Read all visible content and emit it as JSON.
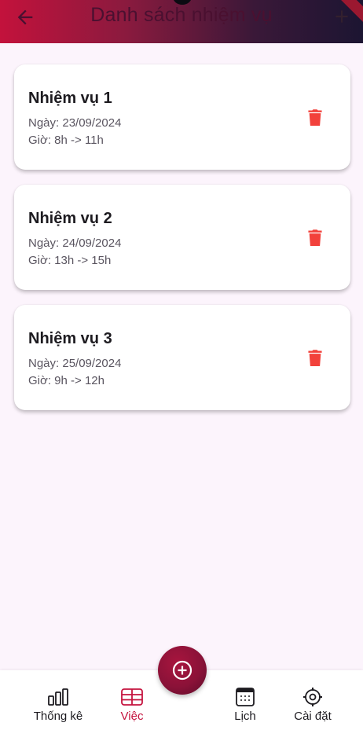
{
  "appbar": {
    "title": "Danh sách nhiệm vụ"
  },
  "tasks": [
    {
      "title": "Nhiệm vụ 1",
      "date": "Ngày: 23/09/2024",
      "time": "Giờ: 8h -> 11h"
    },
    {
      "title": "Nhiệm vụ 2",
      "date": "Ngày: 24/09/2024",
      "time": "Giờ: 13h -> 15h"
    },
    {
      "title": "Nhiệm vụ 3",
      "date": "Ngày: 25/09/2024",
      "time": "Giờ: 9h -> 12h"
    }
  ],
  "bottom_nav": {
    "items": [
      {
        "label": "Thống kê",
        "icon": "bar-chart-icon"
      },
      {
        "label": "Việc",
        "icon": "table-icon",
        "active": true
      },
      {
        "label": "Lịch",
        "icon": "calendar-icon"
      },
      {
        "label": "Cài đặt",
        "icon": "settings-icon"
      }
    ],
    "fab_icon": "add-circle-icon"
  },
  "colors": {
    "accent": "#c5143f",
    "delete": "#f2413b",
    "background": "#fcf4fc"
  }
}
